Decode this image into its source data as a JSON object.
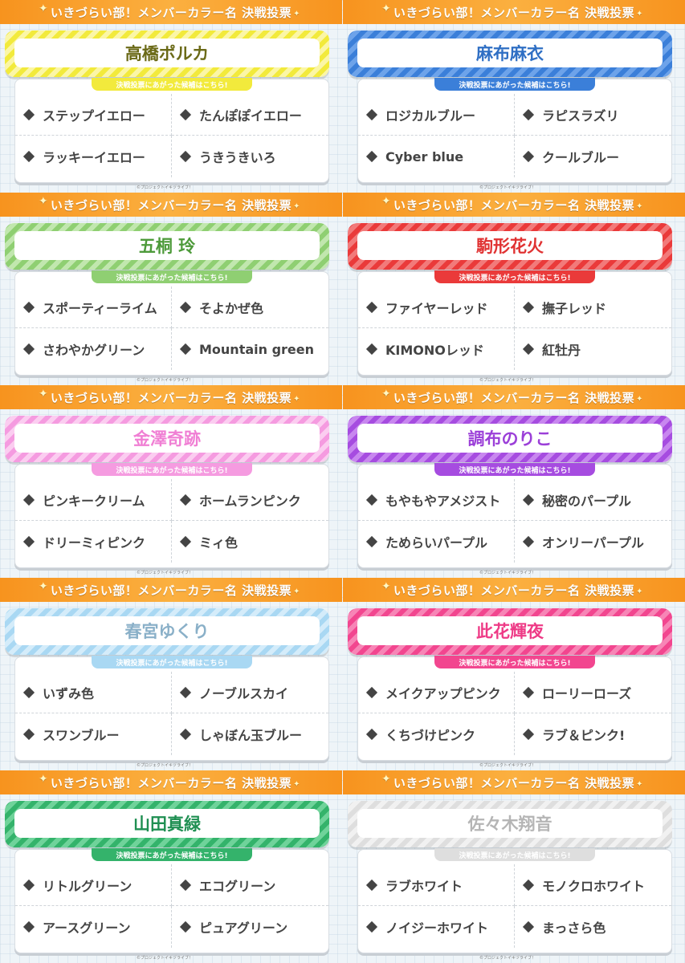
{
  "header_title": "いきづらい部！メンバーカラー名 決戦投票",
  "subtitle": "決戦投票にあがった候補はこちら!",
  "copyright": "©プロジェクトイキヅライブ！",
  "members": [
    {
      "name": "高橋ポルカ",
      "colors": {
        "main": "#f2ea3c",
        "light": "#fbf6a6",
        "text": "#6b6a18"
      },
      "options": [
        "ステップイエロー",
        "たんぽぽイエロー",
        "ラッキーイエロー",
        "うきうきいろ"
      ]
    },
    {
      "name": "麻布麻衣",
      "colors": {
        "main": "#3b7fd9",
        "light": "#6da3ea",
        "text": "#2f6fc4"
      },
      "options": [
        "ロジカルブルー",
        "ラピスラズリ",
        "Cyber blue",
        "クールブルー"
      ]
    },
    {
      "name": "五桐 玲",
      "colors": {
        "main": "#8fcf72",
        "light": "#c1e7ae",
        "text": "#4d9a3a"
      },
      "options": [
        "スポーティーライム",
        "そよかぜ色",
        "さわやかグリーン",
        "Mountain green"
      ]
    },
    {
      "name": "駒形花火",
      "colors": {
        "main": "#ea3a3a",
        "light": "#f27a7a",
        "text": "#e03232"
      },
      "options": [
        "ファイヤーレッド",
        "撫子レッド",
        "KIMONOレッド",
        "紅牡丹"
      ]
    },
    {
      "name": "金澤奇跡",
      "colors": {
        "main": "#f59be0",
        "light": "#fbcdf0",
        "text": "#f07fd4"
      },
      "options": [
        "ピンキークリーム",
        "ホームランピンク",
        "ドリーミィピンク",
        "ミィ色"
      ]
    },
    {
      "name": "調布のりこ",
      "colors": {
        "main": "#a64ce0",
        "light": "#c887ef",
        "text": "#9b3fd8"
      },
      "options": [
        "もやもやアメジスト",
        "秘密のパープル",
        "ためらいパープル",
        "オンリーパープル"
      ]
    },
    {
      "name": "春宮ゆくり",
      "colors": {
        "main": "#a9d8f3",
        "light": "#d4ecfa",
        "text": "#8ab0c8"
      },
      "options": [
        "いずみ色",
        "ノーブルスカイ",
        "スワンブルー",
        "しゃぼん玉ブルー"
      ]
    },
    {
      "name": "此花輝夜",
      "colors": {
        "main": "#f2468f",
        "light": "#f785b6",
        "text": "#ee3a86"
      },
      "options": [
        "メイクアップピンク",
        "ローリーローズ",
        "くちづけピンク",
        "ラブ＆ピンク!"
      ]
    },
    {
      "name": "山田真緑",
      "colors": {
        "main": "#34b36b",
        "light": "#6fd39a",
        "text": "#1f8f52"
      },
      "options": [
        "リトルグリーン",
        "エコグリーン",
        "アースグリーン",
        "ピュアグリーン"
      ]
    },
    {
      "name": "佐々木翔音",
      "colors": {
        "main": "#dedede",
        "light": "#f1f1f1",
        "text": "#b5b5b5"
      },
      "options": [
        "ラブホワイト",
        "モノクロホワイト",
        "ノイジーホワイト",
        "まっさら色"
      ]
    }
  ]
}
